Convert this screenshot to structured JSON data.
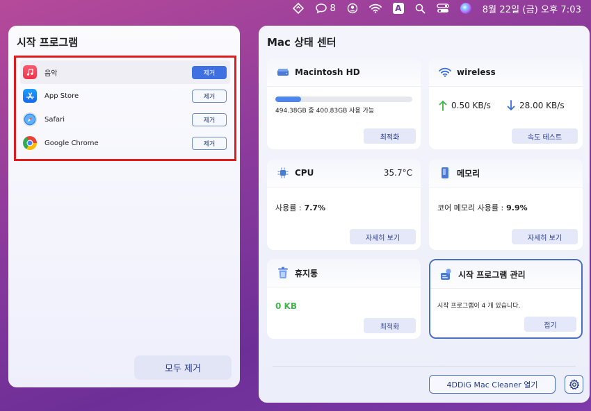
{
  "menubar": {
    "notification_count": "8",
    "input_indicator": "A",
    "clock": "8월 22일 (금) 오후  7:03"
  },
  "startup_panel": {
    "title": "시작 프로그램",
    "apps": [
      {
        "name": "음악",
        "icon": "music-icon",
        "remove_label": "제거"
      },
      {
        "name": "App Store",
        "icon": "app-store-icon",
        "remove_label": "제거"
      },
      {
        "name": "Safari",
        "icon": "safari-icon",
        "remove_label": "제거"
      },
      {
        "name": "Google Chrome",
        "icon": "chrome-icon",
        "remove_label": "제거"
      }
    ],
    "remove_all_label": "모두 제거"
  },
  "status_center": {
    "title": "Mac 상태 센터",
    "disk": {
      "name": "Macintosh HD",
      "usage_text": "494.38GB 중 400.83GB 사용 가능",
      "used_fraction": 0.19,
      "button": "최적화"
    },
    "network": {
      "name": "wireless",
      "upload": "0.50 KB/s",
      "download": "28.00 KB/s",
      "button": "속도 테스트"
    },
    "cpu": {
      "name": "CPU",
      "temperature": "35.7°C",
      "usage_label": "사용률 :",
      "usage_value": "7.7%",
      "button": "자세히 보기"
    },
    "memory": {
      "name": "메모리",
      "usage_label": "코어 메모리 사용률 :",
      "usage_value": "9.9%",
      "button": "자세히 보기"
    },
    "trash": {
      "name": "휴지통",
      "size": "0  KB",
      "button": "최적화"
    },
    "startup_manage": {
      "name": "시작 프로그램 관리",
      "text": "시작 프로그램이 4 개 있습니다.",
      "button": "접기"
    },
    "open_app_label": "4DDiG Mac Cleaner 열기"
  },
  "colors": {
    "accent": "#3f6fe0",
    "highlight_border": "#e01b1b",
    "trash_value": "#3fb54a"
  }
}
